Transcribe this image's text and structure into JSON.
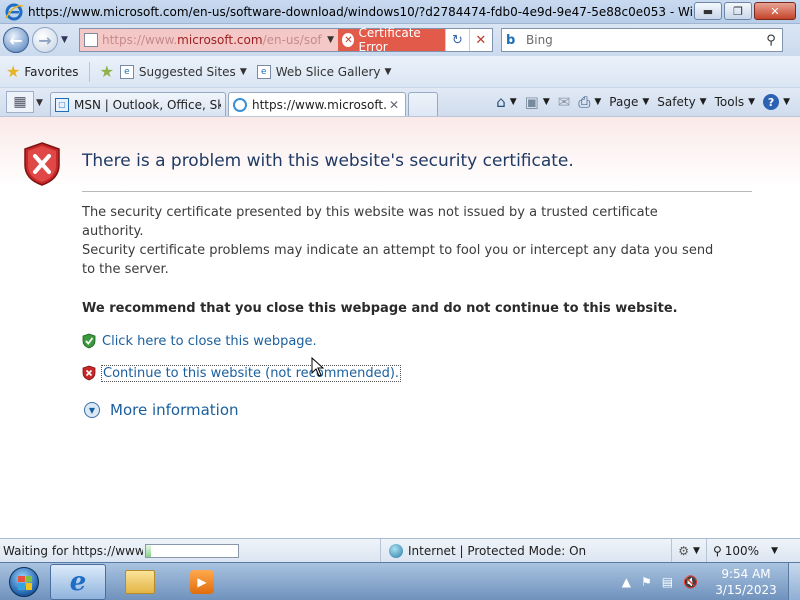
{
  "window": {
    "title": "https://www.microsoft.com/en-us/software-download/windows10/?d2784474-fdb0-4e9d-9e47-5e88c0e053 - Windows Intern..."
  },
  "address_bar": {
    "url_prefix": "https://www.",
    "url_domain": "microsoft.com",
    "url_suffix": "/en-us/sof",
    "cert_error_label": "Certificate Error"
  },
  "search": {
    "placeholder": "Bing"
  },
  "favorites_bar": {
    "favorites_label": "Favorites",
    "suggested_sites_label": "Suggested Sites",
    "web_slice_gallery_label": "Web Slice Gallery"
  },
  "tabs": [
    {
      "label": "MSN | Outlook, Office, Sky..."
    },
    {
      "label": "https://www.microsoft...."
    }
  ],
  "command_bar": {
    "page_label": "Page",
    "safety_label": "Safety",
    "tools_label": "Tools"
  },
  "error_page": {
    "title": "There is a problem with this website's security certificate.",
    "paragraph1": "The security certificate presented by this website was not issued by a trusted certificate authority.",
    "paragraph2": "Security certificate problems may indicate an attempt to fool you or intercept any data you send to the server.",
    "recommendation": "We recommend that you close this webpage and do not continue to this website.",
    "close_link": "Click here to close this webpage.",
    "continue_link": "Continue to this website (not recommended).",
    "more_info": "More information"
  },
  "status_bar": {
    "status_text": "Waiting for https://www.n",
    "progress": 0.05,
    "zone_text": "Internet | Protected Mode: On",
    "zoom": "100%"
  },
  "taskbar": {
    "time": "9:54 AM",
    "date": "3/15/2023"
  },
  "colors": {
    "cert_error_bg": "#e25a4a",
    "link": "#1a5f9e",
    "title_text": "#1f3a63"
  }
}
